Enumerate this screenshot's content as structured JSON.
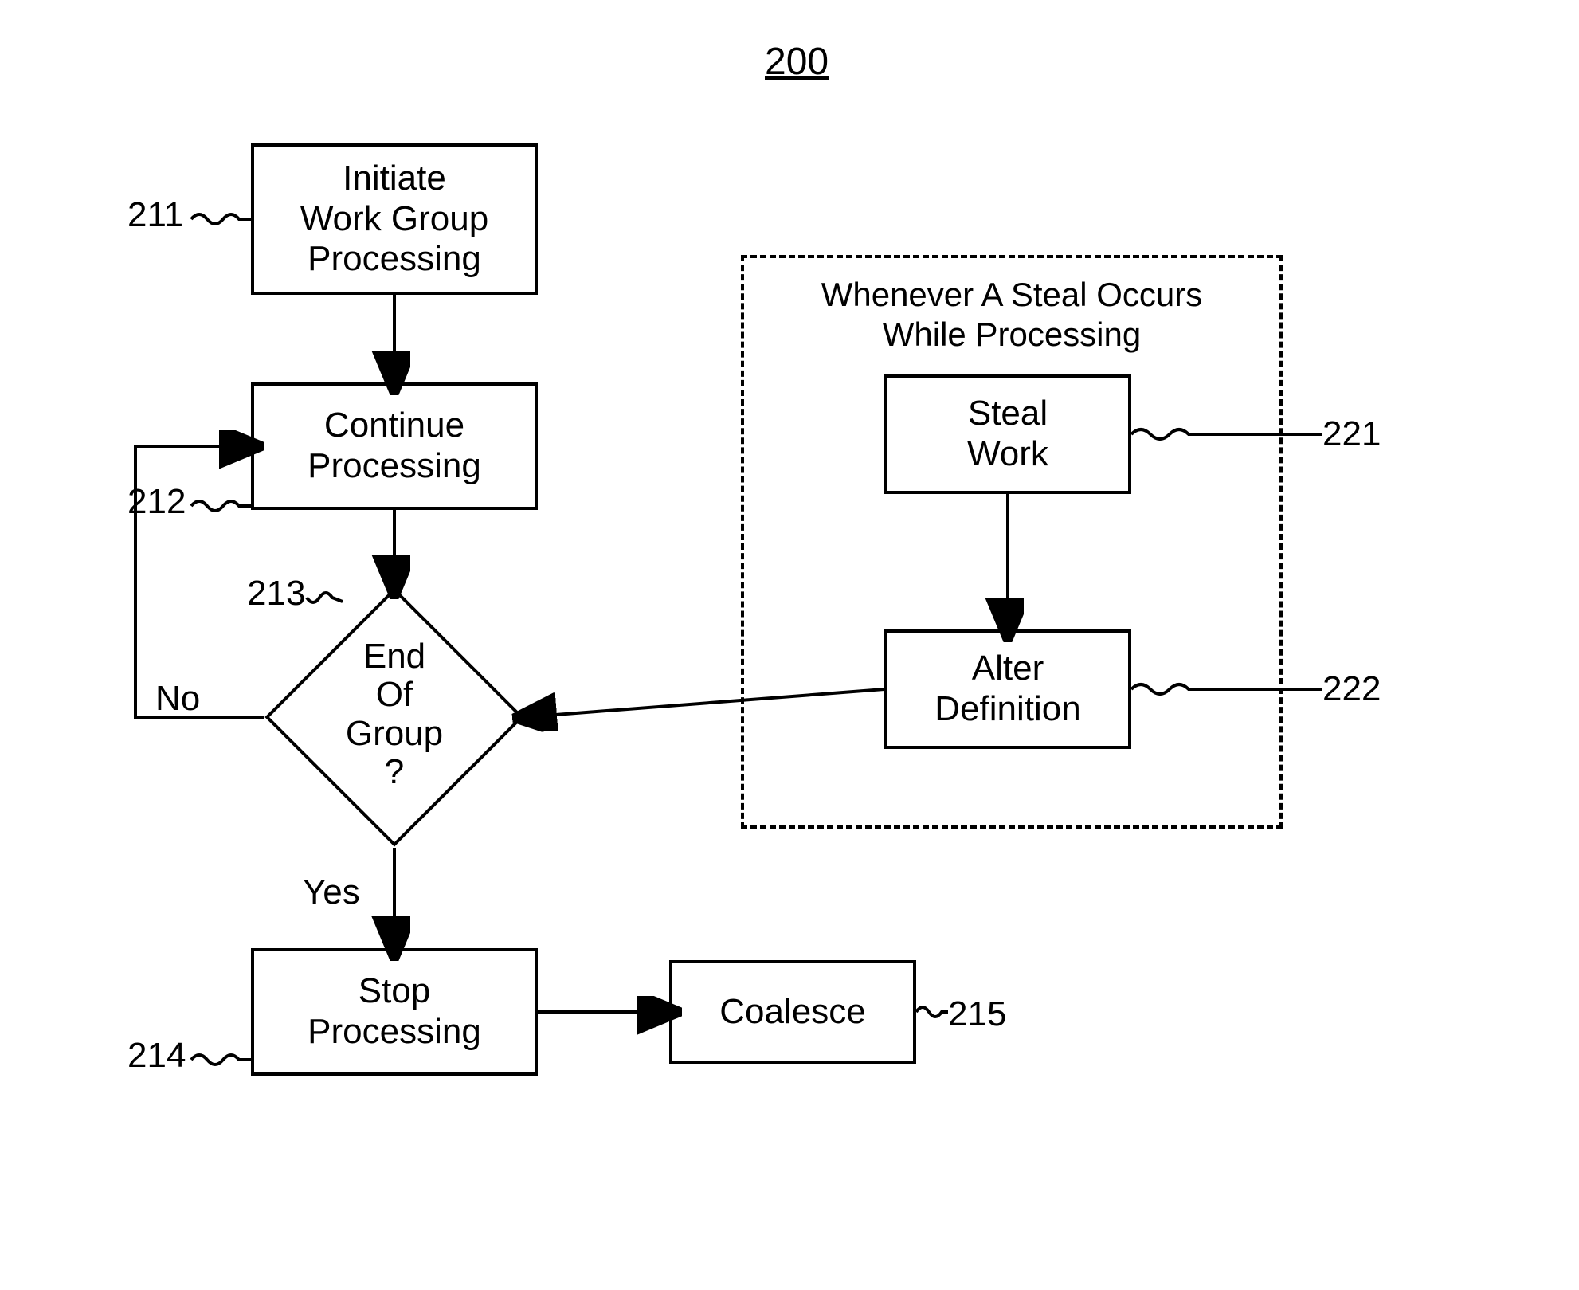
{
  "figure": {
    "number": "200"
  },
  "nodes": {
    "initiate": {
      "ref": "211",
      "text": "Initiate\nWork Group\nProcessing"
    },
    "continue": {
      "ref": "212",
      "text": "Continue\nProcessing"
    },
    "end_group": {
      "ref": "213",
      "text": "End\nOf\nGroup\n?"
    },
    "stop": {
      "ref": "214",
      "text": "Stop\nProcessing"
    },
    "coalesce": {
      "ref": "215",
      "text": "Coalesce"
    },
    "steal": {
      "ref": "221",
      "text": "Steal\nWork"
    },
    "alter": {
      "ref": "222",
      "text": "Alter\nDefinition"
    }
  },
  "edges": {
    "no": "No",
    "yes": "Yes"
  },
  "group": {
    "title": "Whenever A Steal Occurs\nWhile Processing"
  }
}
